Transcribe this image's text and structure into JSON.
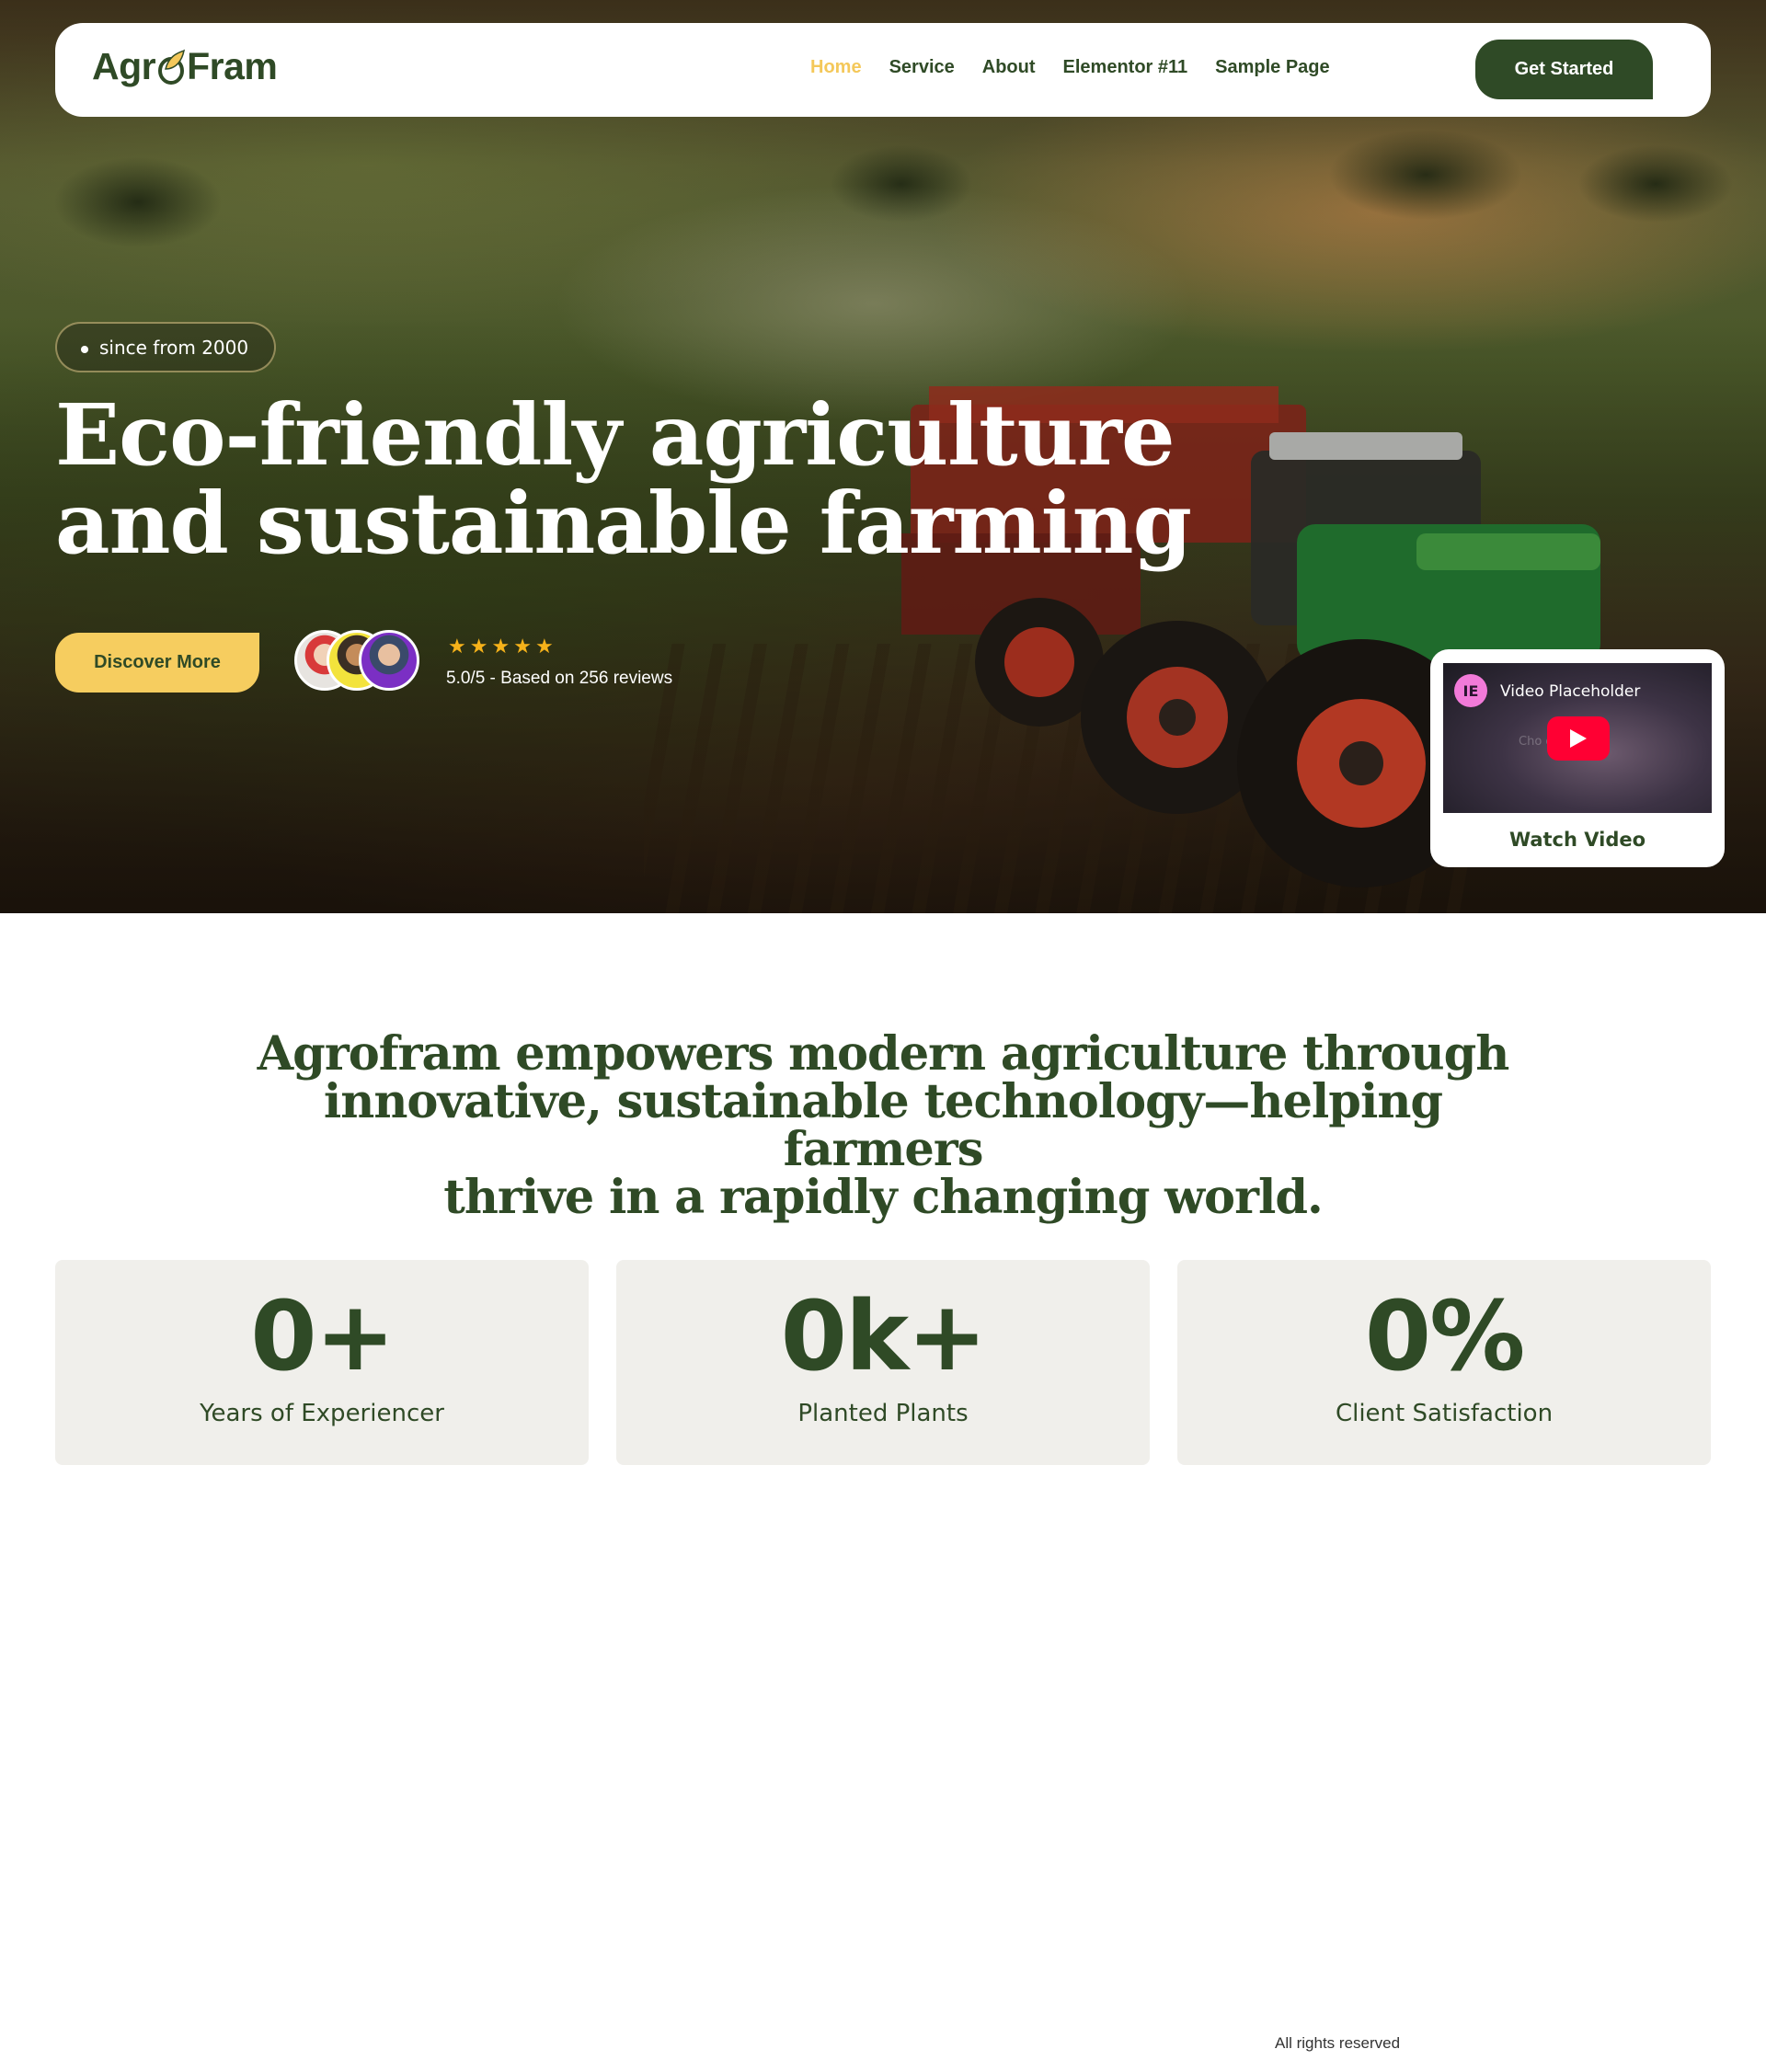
{
  "nav": {
    "logo_prefix": "Agr",
    "logo_suffix": "Fram",
    "items": [
      {
        "label": "Home",
        "active": true
      },
      {
        "label": "Service"
      },
      {
        "label": "About"
      },
      {
        "label": "Elementor #11"
      },
      {
        "label": "Sample Page"
      }
    ],
    "cta_label": "Get Started"
  },
  "hero": {
    "badge": "since from 2000",
    "headline_line1": "Eco-friendly agriculture",
    "headline_line2": "and sustainable farming",
    "discover_label": "Discover More",
    "rating_stars": 5,
    "reviews_text": "5.0/5 - Based on 256 reviews",
    "video": {
      "title": "Video Placeholder",
      "ghost_text": "Cho                deo",
      "label": "Watch Video"
    }
  },
  "mission": {
    "line1": "Agrofram empowers modern agriculture through",
    "line2": "innovative, sustainable technology—helping farmers",
    "line3": "thrive in a rapidly changing world."
  },
  "stats": [
    {
      "value": "0+",
      "label": "Years of Experiencer"
    },
    {
      "value": "0k+",
      "label": "Planted Plants"
    },
    {
      "value": "0%",
      "label": "Client Satisfaction"
    }
  ],
  "footer": {
    "note": "All rights reserved"
  },
  "colors": {
    "brand_green": "#2f4a26",
    "accent_yellow": "#f6cd5f",
    "active_nav": "#f4c85a",
    "stat_bg": "#f0efeb",
    "star": "#f6b21a"
  }
}
